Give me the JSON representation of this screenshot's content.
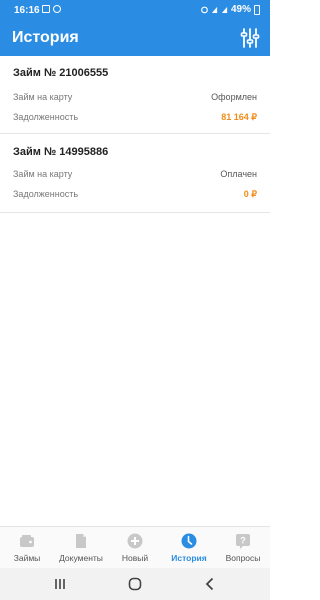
{
  "status_bar": {
    "time": "16:16",
    "battery": "49%"
  },
  "header": {
    "title": "История"
  },
  "loans": [
    {
      "title": "Займ № 21006555",
      "row1_label": "Займ на карту",
      "row1_value": "Оформлен",
      "row2_label": "Задолженность",
      "row2_value": "81 164 ₽"
    },
    {
      "title": "Займ № 14995886",
      "row1_label": "Займ на карту",
      "row1_value": "Оплачен",
      "row2_label": "Задолженность",
      "row2_value": "0 ₽"
    }
  ],
  "bottom_nav": [
    {
      "label": "Займы",
      "icon": "wallet-icon"
    },
    {
      "label": "Документы",
      "icon": "document-icon"
    },
    {
      "label": "Новый",
      "icon": "plus-circle-icon"
    },
    {
      "label": "История",
      "icon": "clock-icon",
      "active": true
    },
    {
      "label": "Вопросы",
      "icon": "question-icon"
    }
  ],
  "colors": {
    "primary": "#2b8ce3",
    "amount": "#f28c1b"
  }
}
